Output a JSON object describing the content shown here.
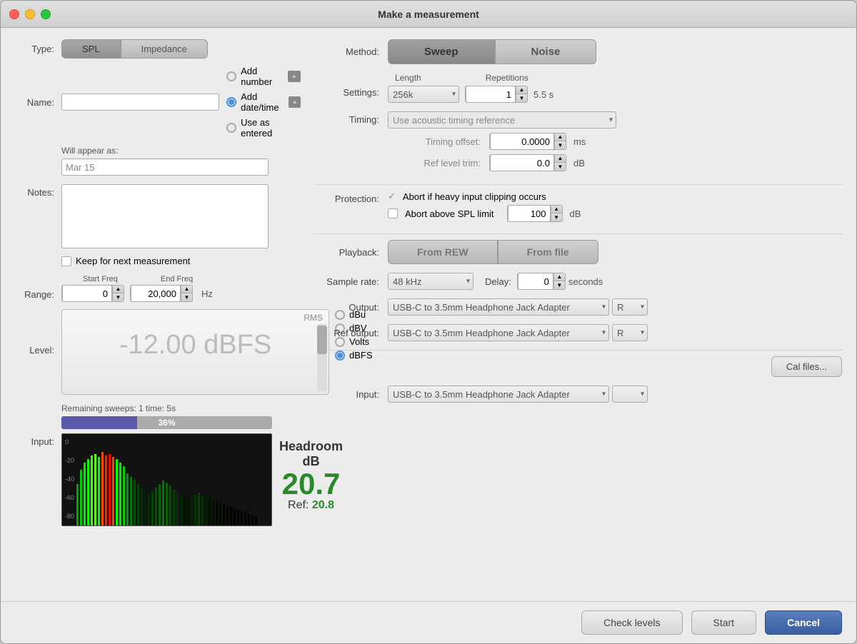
{
  "window": {
    "title": "Make a measurement"
  },
  "type": {
    "label": "Type:",
    "options": [
      "SPL",
      "Impedance"
    ],
    "active": "SPL"
  },
  "method": {
    "label": "Method:",
    "options": [
      "Sweep",
      "Noise"
    ],
    "active": "Sweep"
  },
  "name": {
    "label": "Name:",
    "value": "",
    "placeholder": ""
  },
  "appear_as": {
    "label": "Will appear as:",
    "value": "Mar 15"
  },
  "name_options": {
    "add_number": "Add number",
    "add_datetime": "Add date/time",
    "use_as_entered": "Use as entered",
    "selected": "add_datetime"
  },
  "notes": {
    "label": "Notes:",
    "value": ""
  },
  "keep_for_next": {
    "label": "Keep for next measurement",
    "checked": false
  },
  "range": {
    "label": "Range:",
    "start_freq_label": "Start Freq",
    "end_freq_label": "End Freq",
    "start_freq": "0",
    "end_freq": "20,000",
    "unit": "Hz"
  },
  "level": {
    "label": "Level:",
    "rms": "RMS",
    "value": "-12.00 dBFS",
    "units": [
      "dBu",
      "dBV",
      "Volts",
      "dBFS"
    ],
    "selected_unit": "dBFS"
  },
  "remaining": {
    "text": "Remaining sweeps: 1  time: 5s",
    "progress": 36,
    "progress_label": "36%"
  },
  "input_label": "Input:",
  "headroom": {
    "title": "Headroom",
    "unit": "dB",
    "value": "20.7",
    "ref_label": "Ref:",
    "ref_value": "20.8"
  },
  "settings": {
    "label": "Settings:",
    "length_header": "Length",
    "repetitions_header": "Repetitions",
    "length": "256k",
    "repetitions": "1",
    "duration": "5.5 s"
  },
  "timing": {
    "label": "Timing:",
    "value": "Use acoustic timing reference"
  },
  "timing_offset": {
    "label": "Timing offset:",
    "value": "0.0000",
    "unit": "ms"
  },
  "ref_level_trim": {
    "label": "Ref level trim:",
    "value": "0.0",
    "unit": "dB"
  },
  "protection": {
    "label": "Protection:",
    "abort_heavy": "Abort if heavy input clipping occurs",
    "abort_heavy_checked": true,
    "abort_spl": "Abort above SPL limit",
    "abort_spl_checked": false,
    "spl_limit": "100",
    "spl_unit": "dB"
  },
  "playback": {
    "label": "Playback:",
    "options": [
      "From REW",
      "From file"
    ]
  },
  "sample_rate": {
    "label": "Sample rate:",
    "value": "48 kHz"
  },
  "delay": {
    "label": "Delay:",
    "value": "0",
    "unit": "seconds"
  },
  "output": {
    "label": "Output:",
    "device": "USB-C to 3.5mm Headphone Jack Adapter",
    "channel": "R"
  },
  "ref_output": {
    "label": "Ref output:",
    "device": "USB-C to 3.5mm Headphone Jack Adapter",
    "channel": "R"
  },
  "cal_files": {
    "label": "Cal files..."
  },
  "input_device": {
    "label": "Input:",
    "device": "USB-C to 3.5mm Headphone Jack Adapter",
    "channel": ""
  },
  "buttons": {
    "check_levels": "Check levels",
    "start": "Start",
    "cancel": "Cancel"
  }
}
